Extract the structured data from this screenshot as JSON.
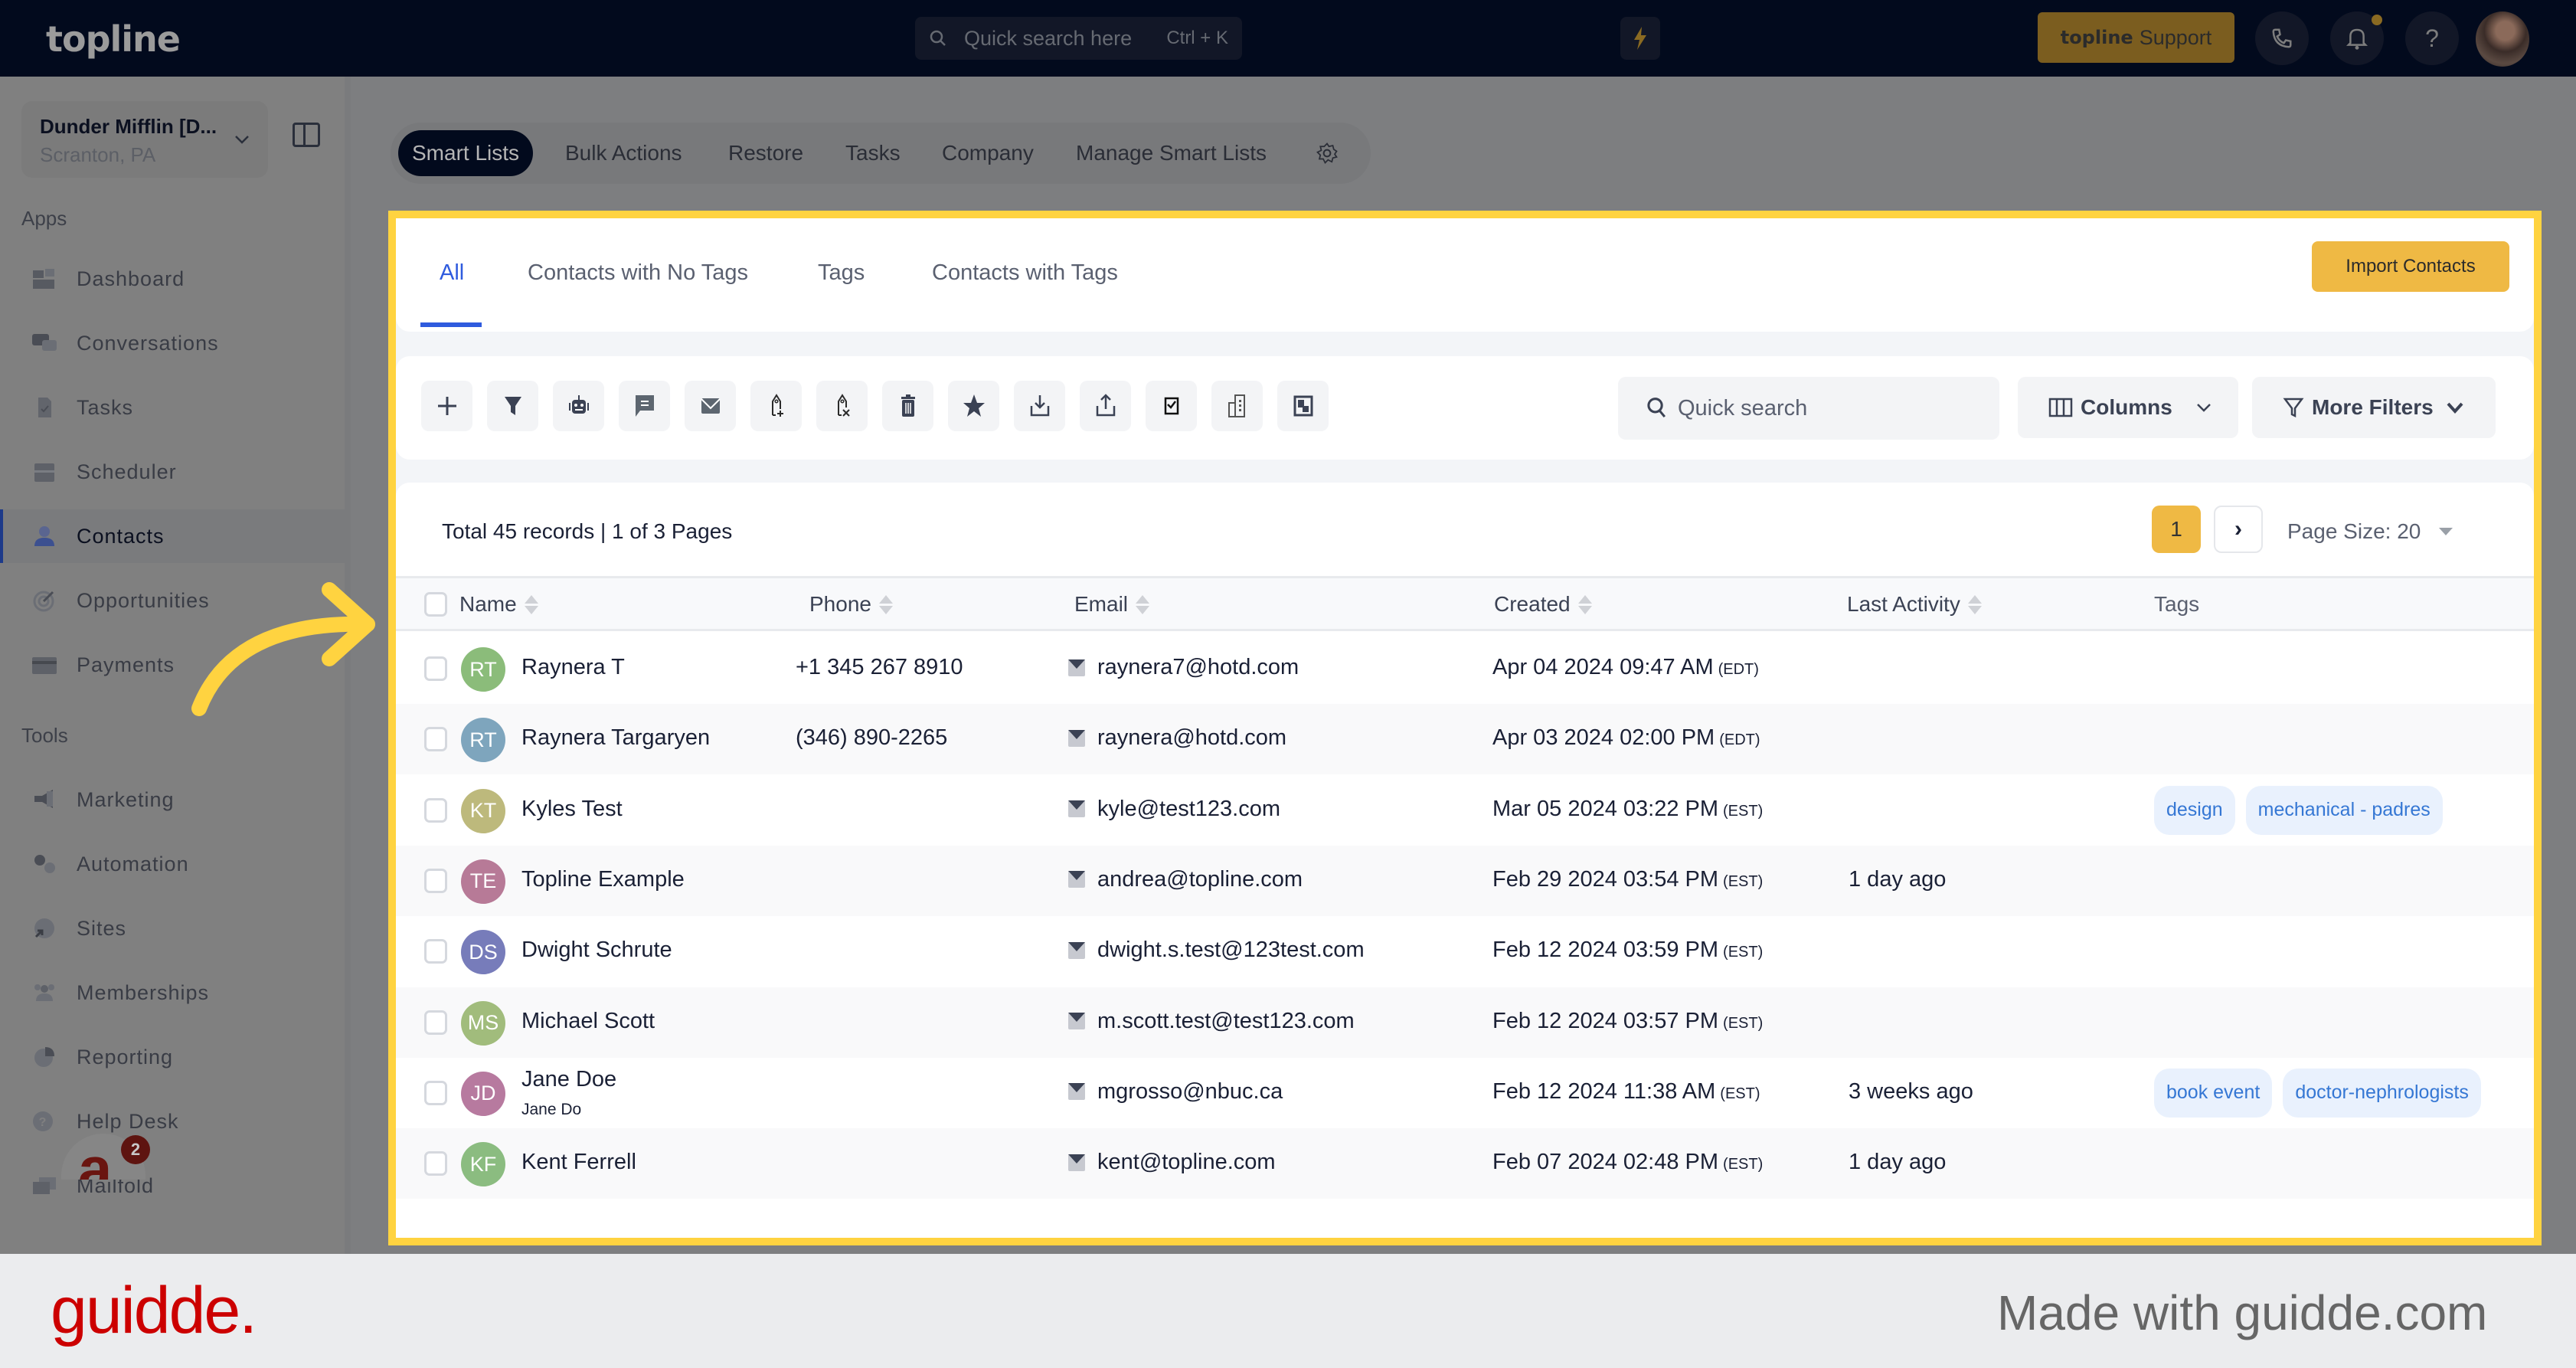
{
  "app": {
    "brand": "topline",
    "global_search": {
      "placeholder": "Quick search here",
      "shortcut": "Ctrl + K"
    },
    "support_button": {
      "brand": "topline",
      "label": "Support"
    },
    "header_icons": [
      "lightning-icon",
      "phone-icon",
      "bell-icon",
      "help-icon",
      "user-avatar"
    ]
  },
  "sidebar": {
    "account": {
      "name": "Dunder Mifflin [D...",
      "location": "Scranton, PA"
    },
    "sections": [
      {
        "title": "Apps",
        "items": [
          {
            "label": "Dashboard",
            "icon": "dashboard-icon",
            "active": false
          },
          {
            "label": "Conversations",
            "icon": "conversations-icon",
            "active": false
          },
          {
            "label": "Tasks",
            "icon": "tasks-icon",
            "active": false
          },
          {
            "label": "Scheduler",
            "icon": "calendar-icon",
            "active": false
          },
          {
            "label": "Contacts",
            "icon": "contacts-icon",
            "active": true
          },
          {
            "label": "Opportunities",
            "icon": "target-icon",
            "active": false
          },
          {
            "label": "Payments",
            "icon": "credit-card-icon",
            "active": false
          }
        ]
      },
      {
        "title": "Tools",
        "items": [
          {
            "label": "Marketing",
            "icon": "megaphone-icon",
            "active": false
          },
          {
            "label": "Automation",
            "icon": "gears-icon",
            "active": false
          },
          {
            "label": "Sites",
            "icon": "globe-icon",
            "active": false
          },
          {
            "label": "Memberships",
            "icon": "users-icon",
            "active": false
          },
          {
            "label": "Reporting",
            "icon": "pie-chart-icon",
            "active": false
          },
          {
            "label": "Help Desk",
            "icon": "help-circle-icon",
            "active": false
          },
          {
            "label": "Mailfold",
            "icon": "mailfold-icon",
            "active": false
          }
        ]
      }
    ],
    "widget_badge_count": "2"
  },
  "top_nav": {
    "items": [
      {
        "label": "Smart Lists",
        "active": true
      },
      {
        "label": "Bulk Actions",
        "active": false
      },
      {
        "label": "Restore",
        "active": false
      },
      {
        "label": "Tasks",
        "active": false
      },
      {
        "label": "Company",
        "active": false
      },
      {
        "label": "Manage Smart Lists",
        "active": false
      }
    ]
  },
  "list_tabs": {
    "items": [
      {
        "label": "All",
        "active": true
      },
      {
        "label": "Contacts with No Tags",
        "active": false
      },
      {
        "label": "Tags",
        "active": false
      },
      {
        "label": "Contacts with Tags",
        "active": false
      }
    ],
    "import_button": "Import Contacts"
  },
  "toolbar": {
    "actions": [
      {
        "name": "add-contact",
        "icon": "plus-icon"
      },
      {
        "name": "filter",
        "icon": "funnel-icon"
      },
      {
        "name": "add-to-workflow",
        "icon": "robot-icon"
      },
      {
        "name": "send-sms",
        "icon": "message-icon"
      },
      {
        "name": "send-email",
        "icon": "email-icon"
      },
      {
        "name": "add-tag",
        "icon": "tag-add-icon"
      },
      {
        "name": "remove-tag",
        "icon": "tag-remove-icon"
      },
      {
        "name": "delete",
        "icon": "trash-icon"
      },
      {
        "name": "review-request",
        "icon": "star-icon"
      },
      {
        "name": "import",
        "icon": "download-icon"
      },
      {
        "name": "export",
        "icon": "upload-icon"
      },
      {
        "name": "send-mail",
        "icon": "mailbox-icon"
      },
      {
        "name": "company",
        "icon": "building-icon"
      },
      {
        "name": "merge",
        "icon": "merge-icon"
      }
    ],
    "search_placeholder": "Quick search",
    "columns_label": "Columns",
    "more_filters_label": "More Filters"
  },
  "table": {
    "summary": "Total 45 records | 1 of 3 Pages",
    "current_page": "1",
    "page_size_label": "Page Size: 20",
    "columns": [
      "Name",
      "Phone",
      "Email",
      "Created",
      "Last Activity",
      "Tags"
    ],
    "rows": [
      {
        "initials": "RT",
        "avatar_color": "#8bbc7a",
        "name": "Raynera T",
        "subname": "",
        "phone": "+1 345 267 8910",
        "email": "raynera7@hotd.com",
        "created": "Apr 04 2024 09:47 AM",
        "tz": "(EDT)",
        "last_activity": "",
        "tags": []
      },
      {
        "initials": "RT",
        "avatar_color": "#7ea5bd",
        "name": "Raynera Targaryen",
        "subname": "",
        "phone": "(346) 890-2265",
        "email": "raynera@hotd.com",
        "created": "Apr 03 2024 02:00 PM",
        "tz": "(EDT)",
        "last_activity": "",
        "tags": []
      },
      {
        "initials": "KT",
        "avatar_color": "#bdb97c",
        "name": "Kyles Test",
        "subname": "",
        "phone": "",
        "email": "kyle@test123.com",
        "created": "Mar 05 2024 03:22 PM",
        "tz": "(EST)",
        "last_activity": "",
        "tags": [
          "design",
          "mechanical - padres"
        ]
      },
      {
        "initials": "TE",
        "avatar_color": "#b77a97",
        "name": "Topline Example",
        "subname": "",
        "phone": "",
        "email": "andrea@topline.com",
        "created": "Feb 29 2024 03:54 PM",
        "tz": "(EST)",
        "last_activity": "1 day ago",
        "tags": []
      },
      {
        "initials": "DS",
        "avatar_color": "#777cba",
        "name": "Dwight Schrute",
        "subname": "",
        "phone": "",
        "email": "dwight.s.test@123test.com",
        "created": "Feb 12 2024 03:59 PM",
        "tz": "(EST)",
        "last_activity": "",
        "tags": []
      },
      {
        "initials": "MS",
        "avatar_color": "#a1bc7c",
        "name": "Michael Scott",
        "subname": "",
        "phone": "",
        "email": "m.scott.test@test123.com",
        "created": "Feb 12 2024 03:57 PM",
        "tz": "(EST)",
        "last_activity": "",
        "tags": []
      },
      {
        "initials": "JD",
        "avatar_color": "#b77a9f",
        "name": "Jane Doe",
        "subname": "Jane Do",
        "phone": "",
        "email": "mgrosso@nbuc.ca",
        "created": "Feb 12 2024 11:38 AM",
        "tz": "(EST)",
        "last_activity": "3 weeks ago",
        "tags": [
          "book event",
          "doctor-nephrologists"
        ]
      },
      {
        "initials": "KF",
        "avatar_color": "#8bbc80",
        "name": "Kent Ferrell",
        "subname": "",
        "phone": "",
        "email": "kent@topline.com",
        "created": "Feb 07 2024 02:48 PM",
        "tz": "(EST)",
        "last_activity": "1 day ago",
        "tags": []
      }
    ]
  },
  "footer": {
    "logo": "guidde.",
    "tagline": "Made with guidde.com"
  },
  "colors": {
    "highlight": "#ffd340",
    "accent_blue": "#2f5bde",
    "primary_yellow": "#efb944",
    "guidde_red": "#cc0000"
  }
}
